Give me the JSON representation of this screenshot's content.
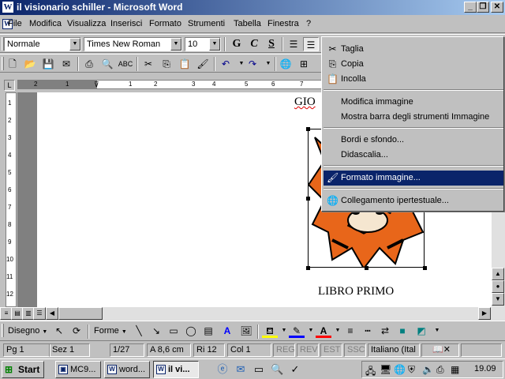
{
  "window": {
    "title": "il visionario schiller - Microsoft Word",
    "min_label": "_",
    "restore_label": "❐",
    "close_label": "✕"
  },
  "menubar": {
    "items": [
      {
        "label": "File"
      },
      {
        "label": "Modifica"
      },
      {
        "label": "Visualizza"
      },
      {
        "label": "Inserisci"
      },
      {
        "label": "Formato"
      },
      {
        "label": "Strumenti"
      },
      {
        "label": "Tabella"
      },
      {
        "label": "Finestra"
      },
      {
        "label": "?"
      }
    ]
  },
  "formatting": {
    "style": "Normale",
    "font": "Times New Roman",
    "size": "10",
    "bold": "G",
    "italic": "C",
    "underline": "S"
  },
  "ruler": {
    "ticks": [
      "2",
      "1",
      "1",
      "2",
      "3",
      "4",
      "5",
      "6",
      "7"
    ],
    "vticks": [
      "1",
      "2",
      "3",
      "4",
      "5",
      "6",
      "7",
      "8",
      "9",
      "10",
      "11",
      "12"
    ]
  },
  "document": {
    "heading_partial": "GIO",
    "chapter": "LIBRO PRIMO"
  },
  "context_menu": {
    "items": [
      {
        "label": "Taglia",
        "icon": "scissors-icon"
      },
      {
        "label": "Copia",
        "icon": "copy-icon"
      },
      {
        "label": "Incolla",
        "icon": "paste-icon"
      },
      {
        "label": "Modifica immagine"
      },
      {
        "label": "Mostra barra degli strumenti Immagine"
      },
      {
        "label": "Bordi e sfondo..."
      },
      {
        "label": "Didascalia..."
      },
      {
        "label": "Formato immagine...",
        "icon": "format-picture-icon",
        "highlighted": true
      },
      {
        "label": "Collegamento ipertestuale...",
        "icon": "hyperlink-icon"
      }
    ]
  },
  "drawing": {
    "draw_label": "Disegno",
    "shapes_label": "Forme"
  },
  "status": {
    "page": "Pg 1",
    "section": "Sez 1",
    "pages": "1/27",
    "at": "A 8,6 cm",
    "line": "Ri 12",
    "col": "Col 1",
    "rec": "REG",
    "rev": "REV",
    "ext": "EST",
    "ovr": "SSC",
    "language": "Italiano (Ital"
  },
  "taskbar": {
    "start": "Start",
    "buttons": [
      {
        "label": "MC9..."
      },
      {
        "label": "word..."
      },
      {
        "label": "il vi..."
      }
    ],
    "clock": "19.09"
  },
  "colors": {
    "titlebar": "#0a246a",
    "highlight": "#0a246a",
    "face": "#c0c0c0",
    "tiger_orange": "#e8661a"
  }
}
